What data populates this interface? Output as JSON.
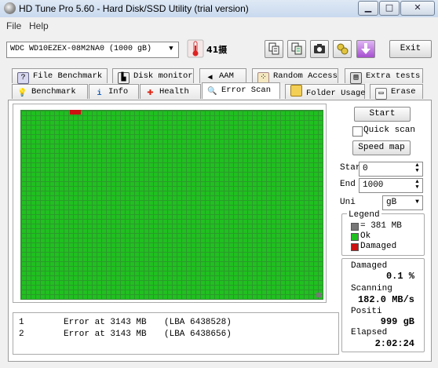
{
  "window": {
    "title": "HD Tune Pro 5.60 - Hard Disk/SSD Utility (trial version)",
    "buttons": {
      "minimize": "▁",
      "maximize": "□",
      "close": "✕"
    }
  },
  "menu": {
    "file": "File",
    "help": "Help"
  },
  "toolbar": {
    "drive_select": "WDC    WD10EZEX-08M2NA0 (1000 gB)",
    "temperature": "41摄",
    "exit_label": "Exit",
    "icons": [
      "copy-icon",
      "copy-all-icon",
      "screenshot-icon",
      "options-icon",
      "save-icon"
    ]
  },
  "tabs_row1": [
    {
      "label": "File Benchmark",
      "icon": "file-benchmark-icon"
    },
    {
      "label": "Disk monitor",
      "icon": "disk-monitor-icon"
    },
    {
      "label": "AAM",
      "icon": "speaker-icon"
    },
    {
      "label": "Random Access",
      "icon": "random-access-icon"
    },
    {
      "label": "Extra tests",
      "icon": "extra-tests-icon"
    }
  ],
  "tabs_row2": [
    {
      "label": "Benchmark",
      "icon": "benchmark-icon"
    },
    {
      "label": "Info",
      "icon": "info-icon"
    },
    {
      "label": "Health",
      "icon": "health-icon"
    },
    {
      "label": "Error Scan",
      "icon": "magnifier-icon"
    },
    {
      "label": "Folder Usage",
      "icon": "folder-icon"
    },
    {
      "label": "Erase",
      "icon": "erase-icon"
    }
  ],
  "active_tab": "Error Scan",
  "controls": {
    "start": "Start",
    "quick_scan": "Quick scan",
    "quick_scan_checked": false,
    "speed_map": "Speed map",
    "start_label": "Star",
    "start_value": "0",
    "end_label": "End",
    "end_value": "1000",
    "unit_label": "Uni",
    "unit_value": "gB"
  },
  "legend": {
    "title": "Legend",
    "items": [
      {
        "label": "= 381 MB",
        "color": "#777777"
      },
      {
        "label": "Ok",
        "color": "#20c020"
      },
      {
        "label": "Damaged",
        "color": "#cc1111"
      }
    ]
  },
  "stats": {
    "damaged_label": "Damaged",
    "damaged_value": "0.1 %",
    "scanning_label": "Scanning",
    "scanning_value": "182.0 MB/s",
    "position_label": "Positi",
    "position_value": "999 gB",
    "elapsed_label": "Elapsed",
    "elapsed_value": "2:02:24"
  },
  "errors": [
    {
      "index": "1",
      "message": "Error at 3143 MB",
      "lba": "(LBA 6438528)"
    },
    {
      "index": "2",
      "message": "Error at 3143 MB",
      "lba": "(LBA 6438656)"
    }
  ],
  "colors": {
    "ok": "#20c020",
    "damaged": "#cc1111",
    "block": "#777777"
  }
}
